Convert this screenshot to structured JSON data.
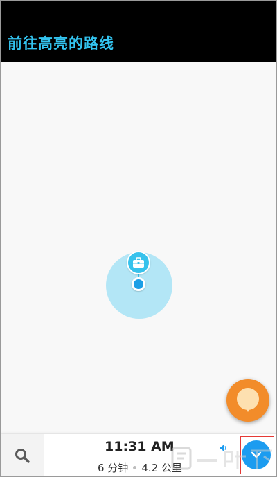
{
  "header": {
    "title": "前往高亮的路线"
  },
  "navigation": {
    "eta_time": "11:31 AM",
    "duration": "6 分钟",
    "distance": "4.2 公里"
  },
  "icons": {
    "search": "search-icon",
    "destination": "briefcase-icon",
    "user_location": "location-dot-icon",
    "orange_button": "orange-pin-icon",
    "sound": "speaker-icon",
    "expand": "chevron-down-icon"
  },
  "colors": {
    "header_bg": "#000000",
    "title": "#33c4f0",
    "accent_blue": "#1c9cf0",
    "accuracy_circle": "#b3e6f6",
    "orange_fab": "#f28c2a",
    "highlight_box": "#e53935"
  },
  "watermark": {
    "text": "一听下载"
  }
}
